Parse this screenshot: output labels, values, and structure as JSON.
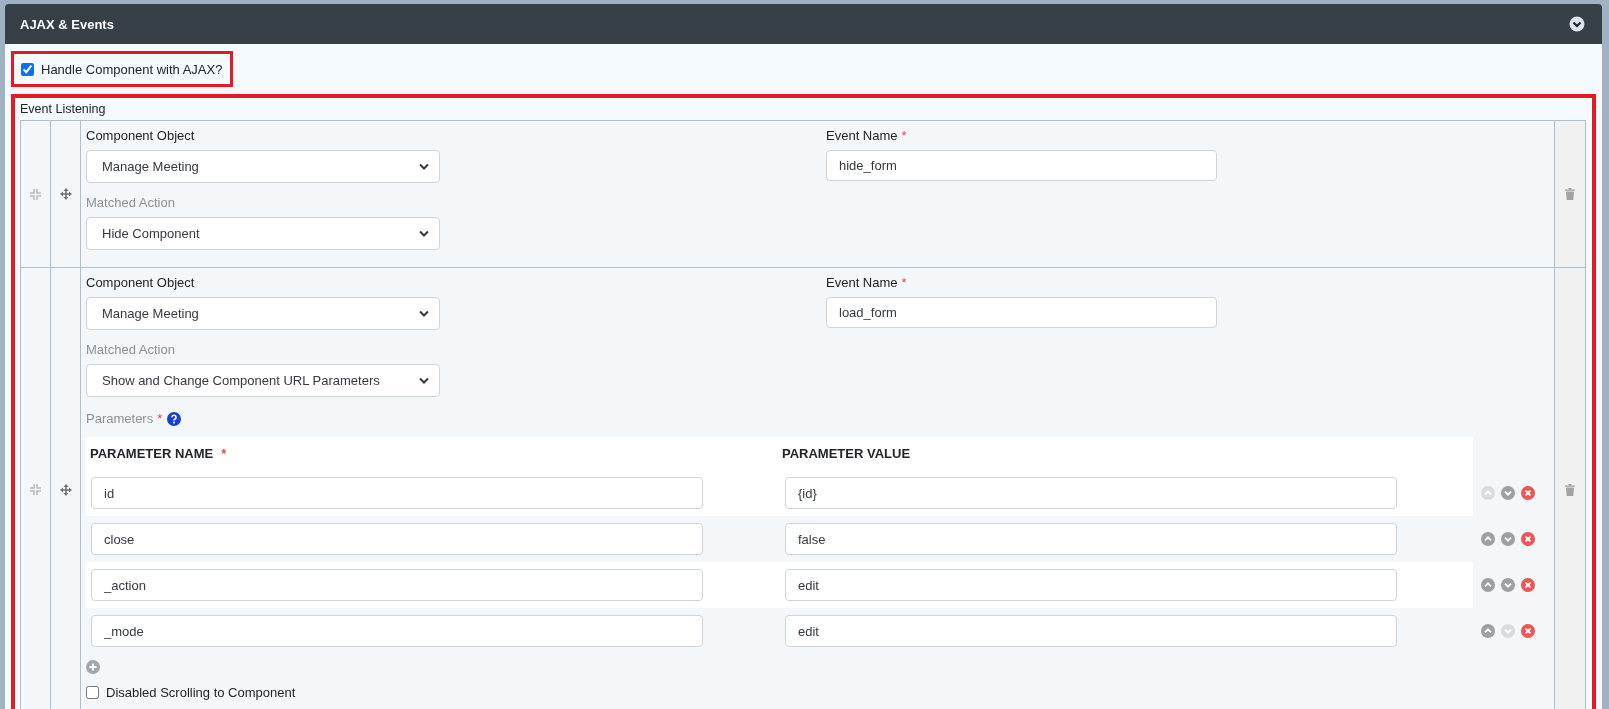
{
  "panel": {
    "title": "AJAX & Events"
  },
  "ajax_toggle": {
    "label": "Handle Component with AJAX?",
    "checked": true
  },
  "event_listening": {
    "label": "Event Listening",
    "listeners": [
      {
        "component_object": {
          "label": "Component Object",
          "value": "Manage Meeting"
        },
        "event_name": {
          "label": "Event Name",
          "required_mark": "*",
          "value": "hide_form"
        },
        "matched_action": {
          "label": "Matched Action",
          "value": "Hide Component"
        }
      },
      {
        "component_object": {
          "label": "Component Object",
          "value": "Manage Meeting"
        },
        "event_name": {
          "label": "Event Name",
          "required_mark": "*",
          "value": "load_form"
        },
        "matched_action": {
          "label": "Matched Action",
          "value": "Show and Change Component URL Parameters"
        },
        "parameters": {
          "label": "Parameters",
          "required_mark": "*",
          "columns": [
            {
              "label": "PARAMETER NAME",
              "required_mark": "*"
            },
            {
              "label": "PARAMETER VALUE"
            }
          ],
          "rows": [
            {
              "name": "id",
              "value": "{id}",
              "can_move_up": false,
              "can_move_down": true
            },
            {
              "name": "close",
              "value": "false",
              "can_move_up": true,
              "can_move_down": true
            },
            {
              "name": "_action",
              "value": "edit",
              "can_move_up": true,
              "can_move_down": true
            },
            {
              "name": "_mode",
              "value": "edit",
              "can_move_up": true,
              "can_move_down": false
            }
          ]
        },
        "disabled_scrolling": {
          "label": "Disabled Scrolling to Component",
          "checked": false
        }
      }
    ]
  }
}
